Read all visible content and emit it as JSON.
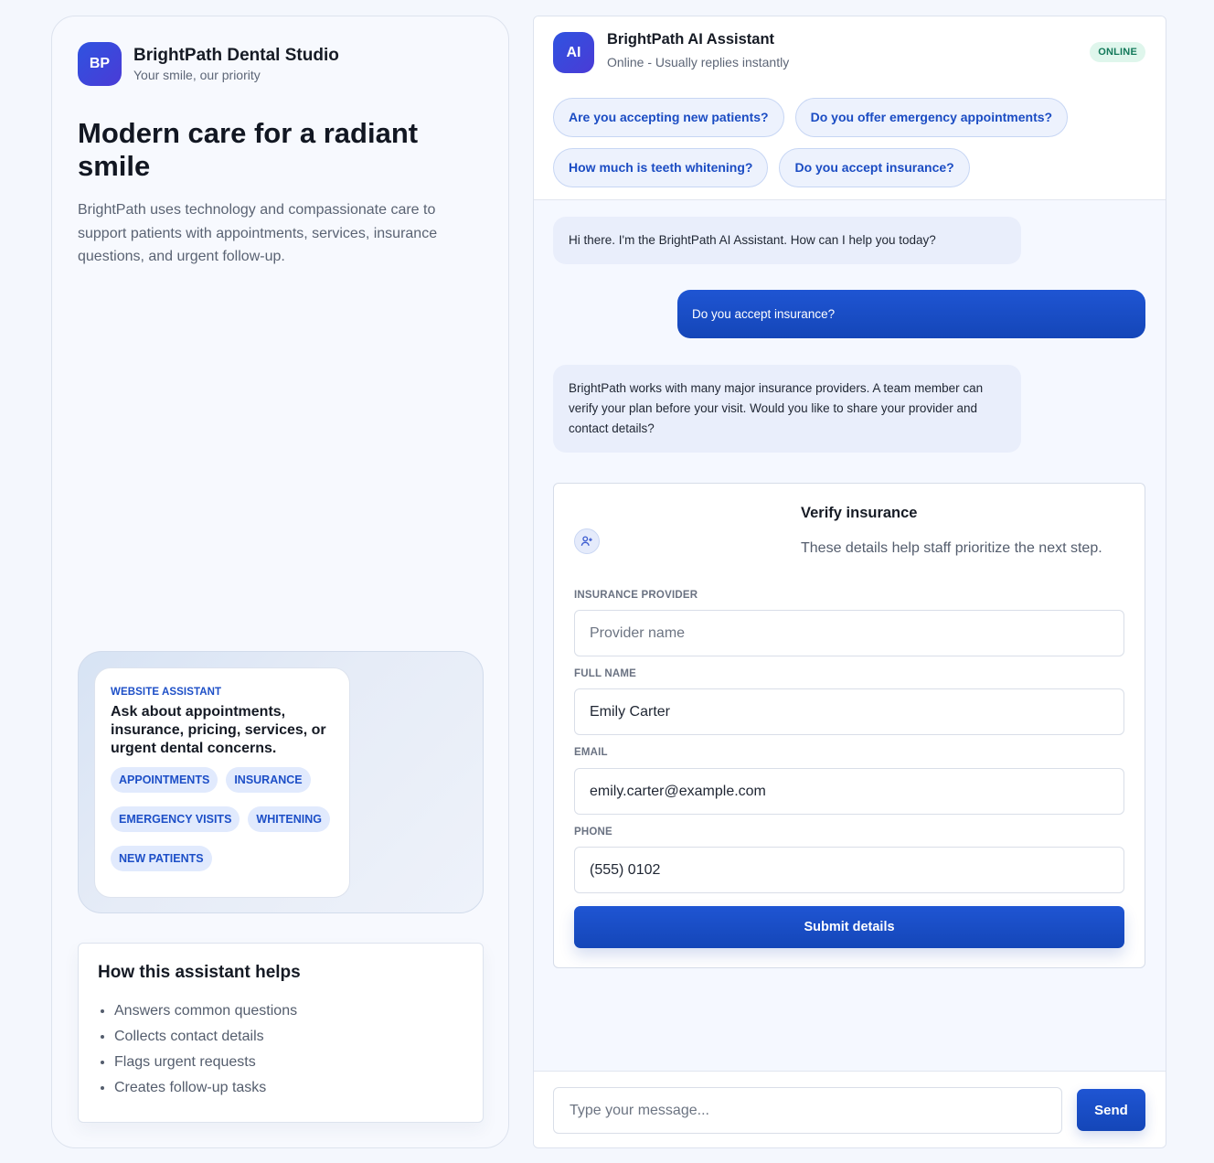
{
  "brand": {
    "initials": "BP",
    "name": "BrightPath Dental Studio",
    "tagline": "Your smile, our priority"
  },
  "hero": {
    "title": "Modern care for a radiant smile",
    "description": "BrightPath uses technology and compassionate care to support patients with appointments, services, insurance questions, and urgent follow-up."
  },
  "assistant_card": {
    "eyebrow": "WEBSITE ASSISTANT",
    "text": "Ask about appointments, insurance, pricing, services, or urgent dental concerns.",
    "chips": [
      "APPOINTMENTS",
      "INSURANCE",
      "EMERGENCY VISITS",
      "WHITENING",
      "NEW PATIENTS"
    ]
  },
  "helps": {
    "title": "How this assistant helps",
    "items": [
      "Answers common questions",
      "Collects contact details",
      "Flags urgent requests",
      "Creates follow-up tasks"
    ]
  },
  "chat": {
    "avatar": "AI",
    "name": "BrightPath AI Assistant",
    "status": "Online - Usually replies instantly",
    "badge": "ONLINE",
    "quick_replies": [
      "Are you accepting new patients?",
      "Do you offer emergency appointments?",
      "How much is teeth whitening?",
      "Do you accept insurance?"
    ],
    "messages": [
      {
        "from": "bot",
        "text": "Hi there. I'm the BrightPath AI Assistant. How can I help you today?"
      },
      {
        "from": "user",
        "text": "Do you accept insurance?"
      },
      {
        "from": "bot",
        "text": "BrightPath works with many major insurance providers. A team member can verify your plan before your visit. Would you like to share your provider and contact details?"
      }
    ]
  },
  "form": {
    "icon": "user-plus-icon",
    "title": "Verify insurance",
    "subtitle": "These details help staff prioritize the next step.",
    "fields": [
      {
        "label": "INSURANCE PROVIDER",
        "value": "",
        "placeholder": "Provider name"
      },
      {
        "label": "FULL NAME",
        "value": "Emily Carter",
        "placeholder": ""
      },
      {
        "label": "EMAIL",
        "value": "emily.carter@example.com",
        "placeholder": ""
      },
      {
        "label": "PHONE",
        "value": "(555) 0102",
        "placeholder": ""
      }
    ],
    "submit_label": "Submit details"
  },
  "composer": {
    "placeholder": "Type your message...",
    "send_label": "Send"
  },
  "colors": {
    "accent": "#1f55d3",
    "chip_bg": "#e1eafd",
    "online_bg": "#dff6ec",
    "online_text": "#13795a"
  }
}
